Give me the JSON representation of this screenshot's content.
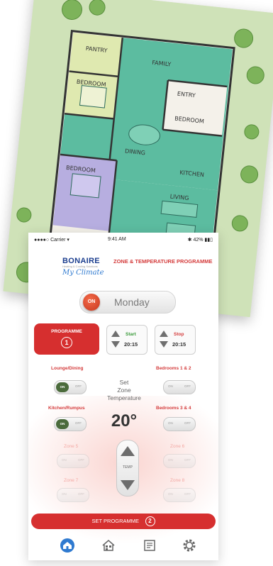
{
  "status_bar": {
    "carrier": "●●●●○ Carrier ▾",
    "time": "9:41 AM",
    "battery": "✱ 42% ▮▮▯"
  },
  "logo": {
    "brand": "BONAIRE",
    "tagline": "Heating & Cooling Solutions",
    "sub": "My Climate"
  },
  "header_title": "ZONE & TEMPERATURE PROGRAMME",
  "power": {
    "label": "ON"
  },
  "day": "Monday",
  "programme": {
    "label": "PROGRAMME",
    "number": "1"
  },
  "start": {
    "label": "Start",
    "time": "20:15",
    "color": "#3a9a3a"
  },
  "stop": {
    "label": "Stop",
    "time": "20:15",
    "color": "#d43b3b"
  },
  "zones": [
    {
      "name": "Lounge/Dining",
      "on": true
    },
    {
      "name": "Bedrooms 1 & 2",
      "on": false
    },
    {
      "name": "Kitchen/Rumpus",
      "on": true
    },
    {
      "name": "Bedrooms 3 & 4",
      "on": false
    },
    {
      "name": "Zone 5",
      "on": false
    },
    {
      "name": "Zone 6",
      "on": false
    },
    {
      "name": "Zone 7",
      "on": false
    },
    {
      "name": "Zone 8",
      "on": false
    }
  ],
  "toggle": {
    "on": "ON",
    "off": "OFF"
  },
  "set_zone_temp": {
    "line1": "Set",
    "line2": "Zone",
    "line3": "Temperature"
  },
  "temperature": "20°",
  "temp_control_label": "TEMP",
  "set_programme": {
    "label": "SET PROGRAMME",
    "number": "2"
  },
  "tabs": [
    "home-icon",
    "house-zones-icon",
    "programme-icon",
    "settings-icon"
  ],
  "colors": {
    "accent": "#d62f2f",
    "brand_blue": "#1c3f8f",
    "active_tab": "#2f7ad0"
  },
  "floor_plan": {
    "rooms": [
      "PANTRY",
      "FAMILY",
      "BEDROOM",
      "ENTRY",
      "BEDROOM",
      "DINING",
      "KITCHEN",
      "BEDROOM",
      "LIVING"
    ]
  }
}
